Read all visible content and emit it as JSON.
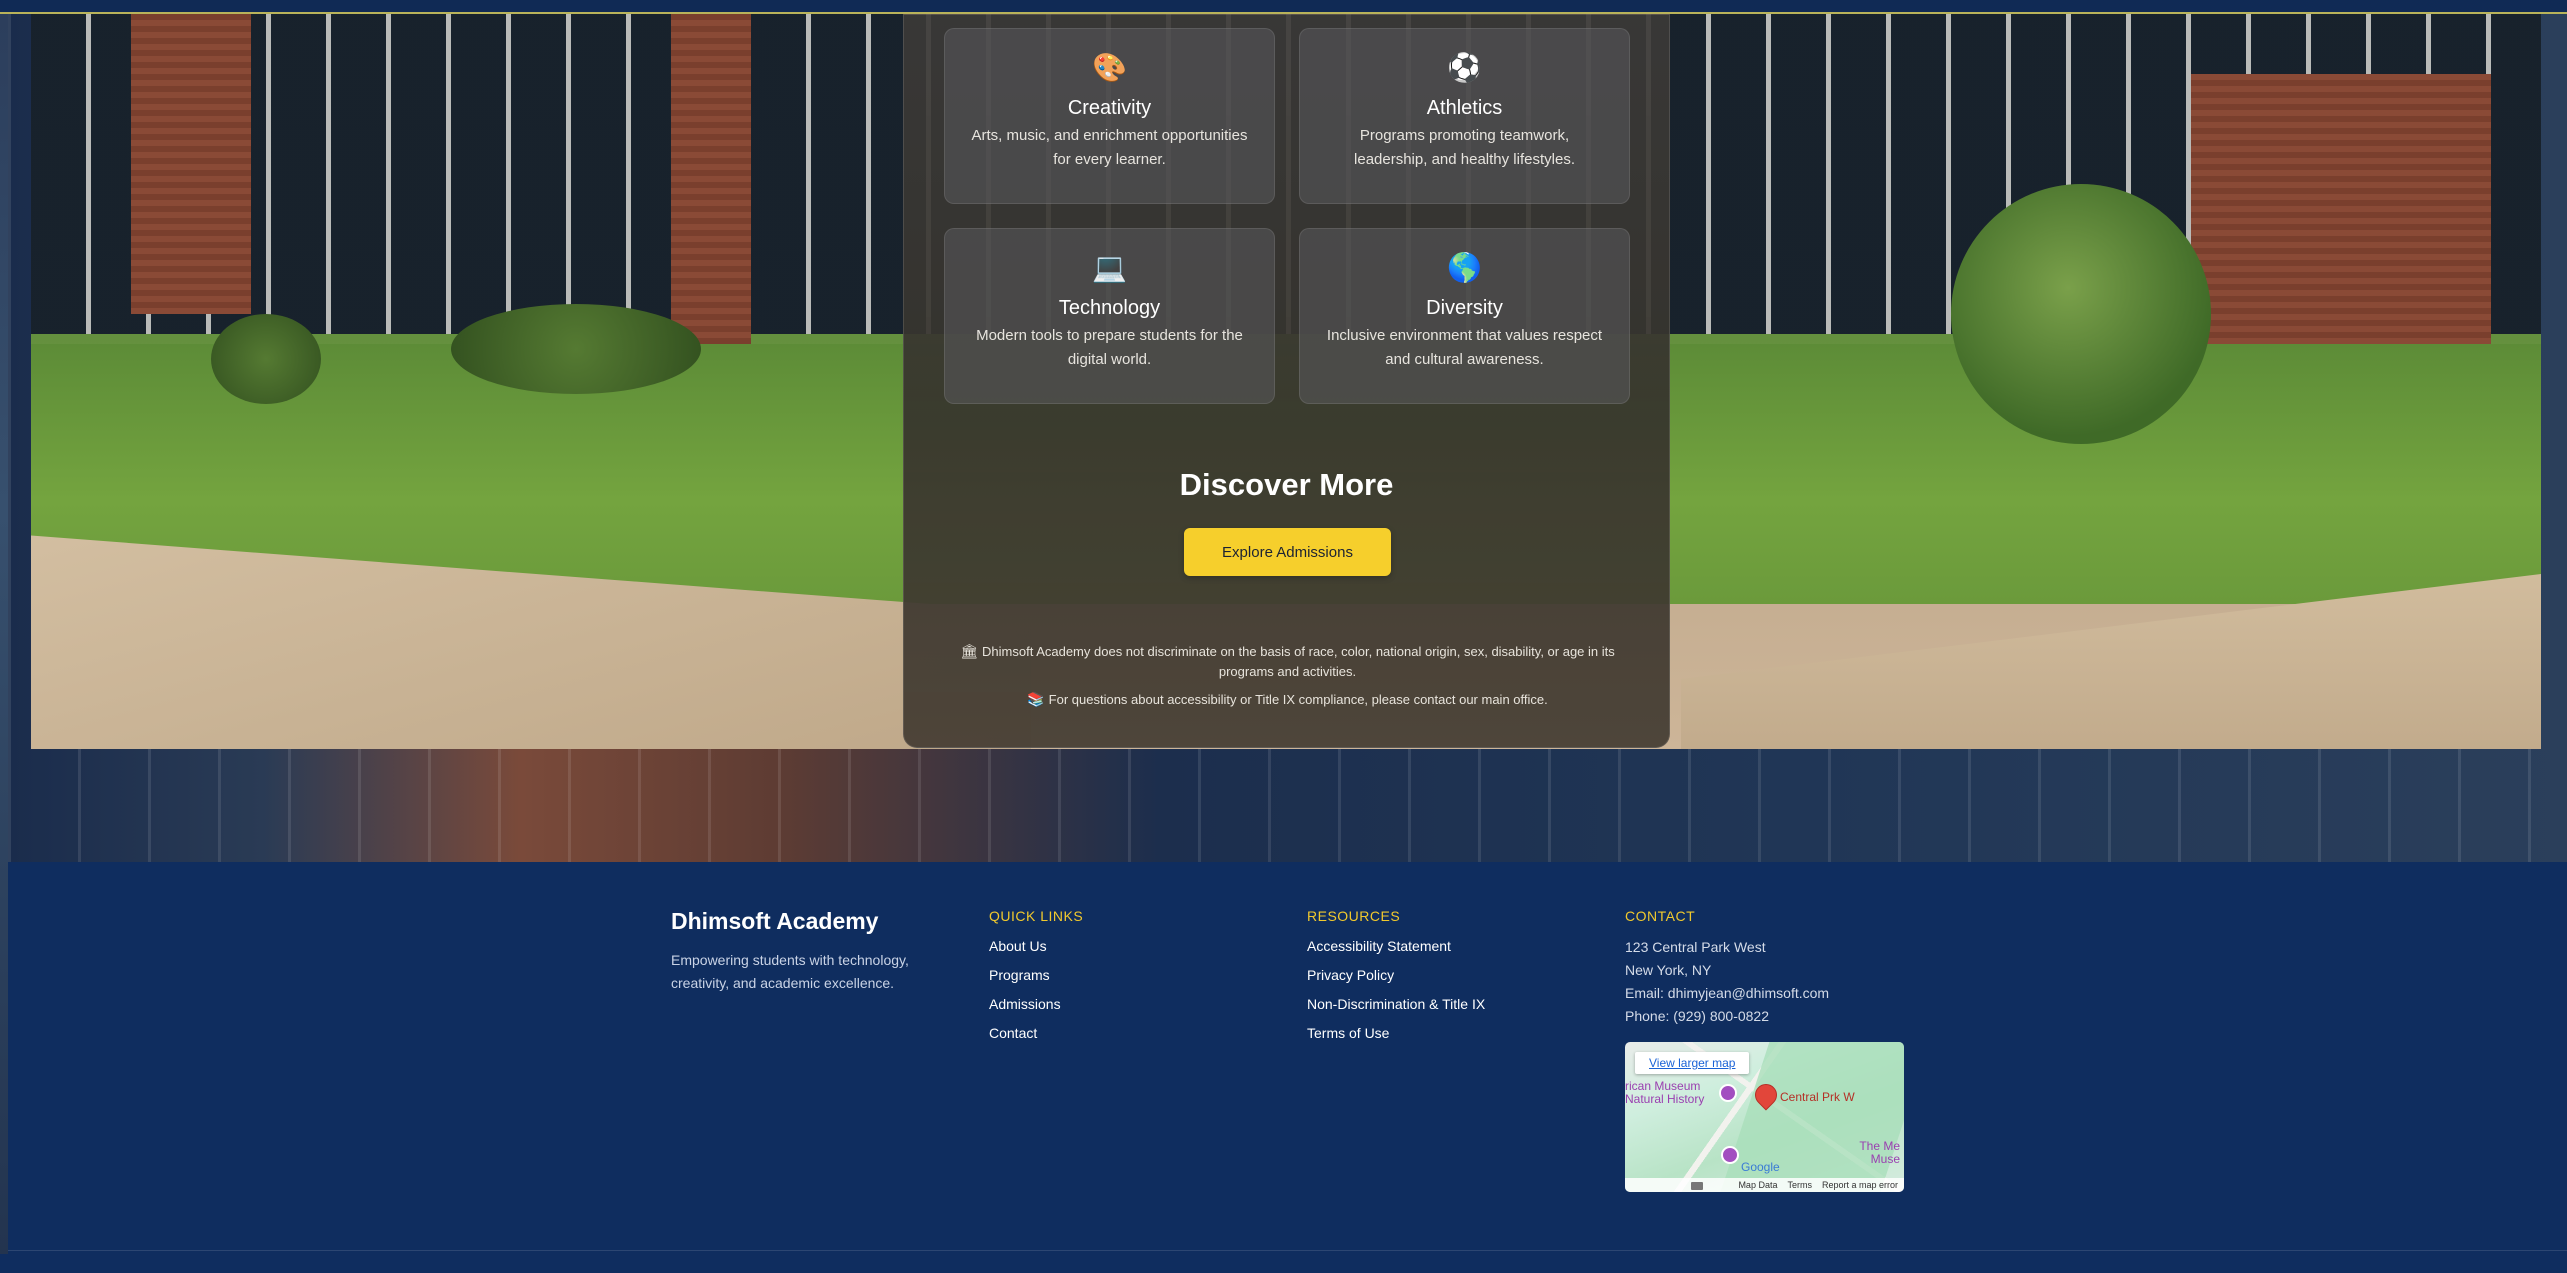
{
  "features": [
    {
      "icon": "🎨",
      "title": "Creativity",
      "description": "Arts, music, and enrichment opportunities for every learner."
    },
    {
      "icon": "⚽",
      "title": "Athletics",
      "description": "Programs promoting teamwork, leadership, and healthy lifestyles."
    },
    {
      "icon": "💻",
      "title": "Technology",
      "description": "Modern tools to prepare students for the digital world."
    },
    {
      "icon": "🌎",
      "title": "Diversity",
      "description": "Inclusive environment that values respect and cultural awareness."
    }
  ],
  "discover": {
    "heading": "Discover More",
    "button_label": "Explore Admissions"
  },
  "notices": {
    "nondiscrimination_icon": "🏛",
    "nondiscrimination": "Dhimsoft Academy does not discriminate on the basis of race, color, national origin, sex, disability, or age in its programs and activities.",
    "accessibility_icon": "📚",
    "accessibility": "For questions about accessibility or Title IX compliance, please contact our main office."
  },
  "footer": {
    "brand": "Dhimsoft Academy",
    "tagline": "Empowering students with technology, creativity, and academic excellence.",
    "quick_links": {
      "heading": "QUICK LINKS",
      "items": [
        "About Us",
        "Programs",
        "Admissions",
        "Contact"
      ]
    },
    "resources": {
      "heading": "RESOURCES",
      "items": [
        "Accessibility Statement",
        "Privacy Policy",
        "Non-Discrimination & Title IX",
        "Terms of Use"
      ]
    },
    "contact": {
      "heading": "CONTACT",
      "address1": "123 Central Park West",
      "address2": "New York, NY",
      "email": "Email: dhimyjean@dhimsoft.com",
      "phone": "Phone: (929) 800-0822"
    },
    "map": {
      "view_larger": "View larger map",
      "pin_label": "Central Prk W",
      "museum_label_1": "rican Museum",
      "museum_label_2": "Natural History",
      "met_label_1": "The Me",
      "met_label_2": "Muse",
      "google": "Google",
      "map_data": "Map Data",
      "terms": "Terms",
      "report": "Report a map error"
    }
  },
  "colors": {
    "accent": "#f6cf2c",
    "footer_bg": "#0f2d5f",
    "heading_yellow": "#f1c92d"
  }
}
